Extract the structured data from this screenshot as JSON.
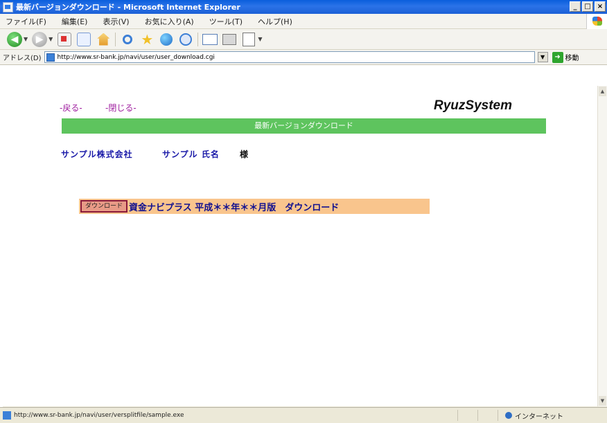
{
  "window": {
    "title": "最新バージョンダウンロード - Microsoft Internet Explorer",
    "buttons": {
      "minimize": "_",
      "restore": "□",
      "close": "×"
    }
  },
  "menu": {
    "items": [
      "ファイル(F)",
      "編集(E)",
      "表示(V)",
      "お気に入り(A)",
      "ツール(T)",
      "ヘルプ(H)"
    ]
  },
  "toolbar": {
    "icons": [
      "back-icon",
      "forward-icon",
      "stop-icon",
      "refresh-icon",
      "home-icon",
      "search-icon",
      "favorites-icon",
      "media-icon",
      "history-icon",
      "mail-icon",
      "print-icon",
      "edit-icon"
    ]
  },
  "address": {
    "label": "アドレス(D)",
    "url": "http://www.sr-bank.jp/navi/user/user_download.cgi",
    "go_label": "移動"
  },
  "page": {
    "back_link": "-戻る-",
    "close_link": "-閉じる-",
    "logo": "RyuzSystem",
    "header_bar": "最新バージョンダウンロード",
    "company": "サンプル株式会社",
    "person": "サンプル 氏名",
    "honorific": "様",
    "download_button": "ダウンロード",
    "download_text": "資金ナビプラス 平成＊＊年＊＊月版　ダウンロード",
    "colors": {
      "header_bar": "#5ec45e",
      "download_row": "#f9c58d",
      "link": "#a020a0",
      "name_text": "#1a1aa8"
    }
  },
  "status": {
    "text": "http://www.sr-bank.jp/navi/user/versplitfile/sample.exe",
    "zone": "インターネット"
  }
}
